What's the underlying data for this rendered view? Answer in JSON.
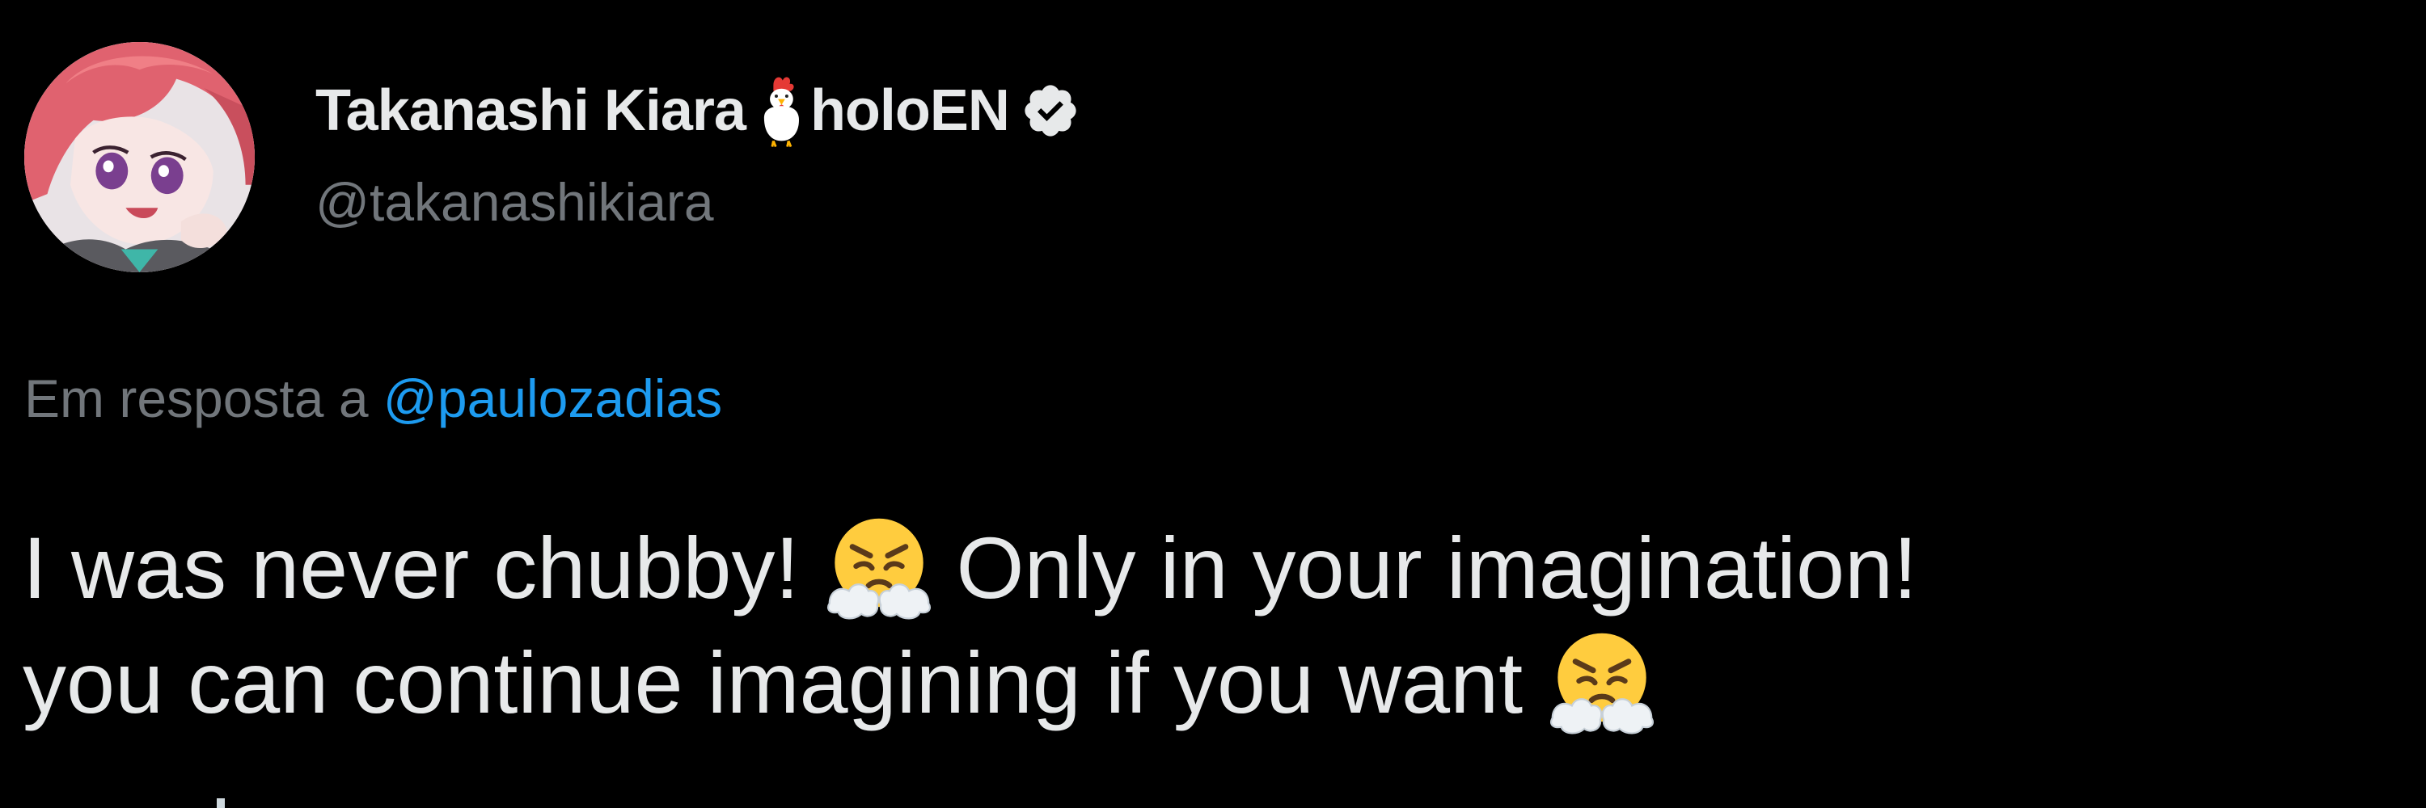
{
  "tweet": {
    "author": {
      "display_name": "Takanashi Kiara",
      "affiliation": "holoEN",
      "handle": "@takanashikiara",
      "badge_icon": "chicken-icon",
      "verified_icon": "verified-badge-icon"
    },
    "reply": {
      "prefix": "Em resposta a",
      "mention": "@paulozadias"
    },
    "text": {
      "line1_part1": "I was never chubby!",
      "line1_part2": "Only in your imagination!",
      "line2_part1": "you can continue imagining if you want",
      "emoji_name": "face-with-steam-from-nose-emoji"
    }
  },
  "colors": {
    "background": "#000000",
    "primary_text": "#e7e9ea",
    "secondary_text": "#71767b",
    "link": "#1d9bf0"
  }
}
